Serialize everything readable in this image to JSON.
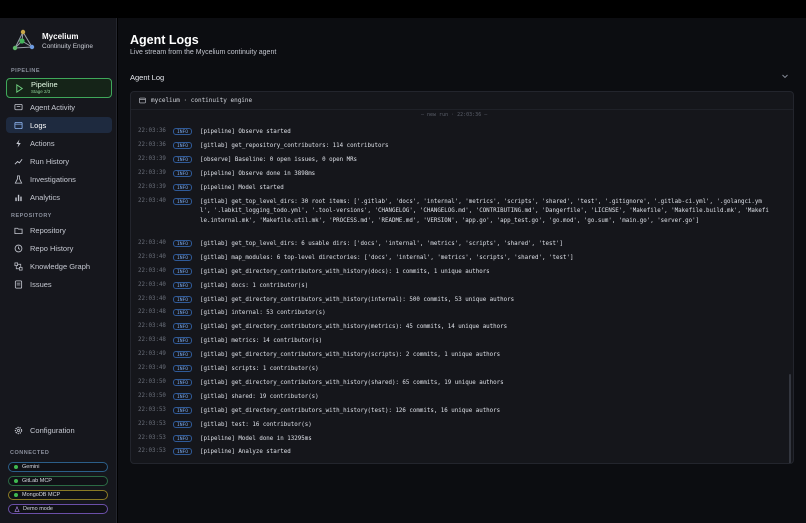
{
  "brand": {
    "name": "Mycelium",
    "subtitle": "Continuity Engine"
  },
  "sidebar": {
    "section_pipeline": "PIPELINE",
    "pipeline": {
      "label": "Pipeline",
      "sub": "Stage 2/3"
    },
    "items_main": [
      {
        "label": "Agent Activity",
        "icon": "chat-icon"
      },
      {
        "label": "Logs",
        "icon": "logs-icon",
        "active": true
      },
      {
        "label": "Actions",
        "icon": "bolt-icon"
      },
      {
        "label": "Run History",
        "icon": "trend-icon"
      },
      {
        "label": "Investigations",
        "icon": "flask-icon"
      },
      {
        "label": "Analytics",
        "icon": "bar-chart-icon"
      }
    ],
    "section_repo": "REPOSITORY",
    "items_repo": [
      {
        "label": "Repository",
        "icon": "folder-icon"
      },
      {
        "label": "Repo History",
        "icon": "history-icon"
      },
      {
        "label": "Knowledge Graph",
        "icon": "graph-icon"
      },
      {
        "label": "Issues",
        "icon": "issues-icon"
      }
    ],
    "configuration": "Configuration",
    "connected_label": "CONNECTED",
    "connections": [
      {
        "label": "Gemini",
        "color": "#3fb950",
        "border": "#2b5e88"
      },
      {
        "label": "GitLab MCP",
        "color": "#3fb950",
        "border": "#2b6a44"
      },
      {
        "label": "MongoDB MCP",
        "color": "#3fb950",
        "border": "#8a7a25"
      },
      {
        "label": "Demo mode",
        "color": "#b48cf0",
        "border": "#6b4fa8"
      }
    ]
  },
  "main": {
    "title": "Agent Logs",
    "subtitle": "Live stream from the Mycelium continuity agent",
    "panel_title": "Agent Log",
    "log_header": "mycelium · continuity engine",
    "divider": "— new run · 22:03:36 —",
    "level": "INFO",
    "logs": [
      {
        "t": "22:03:36",
        "m": "[pipeline] Observe started"
      },
      {
        "t": "22:03:36",
        "m": "[gitlab] get_repository_contributors: 114 contributors"
      },
      {
        "t": "22:03:39",
        "m": "[observe] Baseline: 0 open issues, 0 open MRs"
      },
      {
        "t": "22:03:39",
        "m": "[pipeline] Observe done in 3898ms"
      },
      {
        "t": "22:03:39",
        "m": "[pipeline] Model started"
      },
      {
        "t": "22:03:40",
        "m": "[gitlab] get_top_level_dirs: 30 root items: ['.gitlab', 'docs', 'internal', 'metrics', 'scripts', 'shared', 'test', '.gitignore', '.gitlab-ci.yml', '.golangci.yml', '.labkit_logging_todo.yml', '.tool-versions', 'CHANGELOG', 'CHANGELOG.md', 'CONTRIBUTING.md', 'Dangerfile', 'LICENSE', 'Makefile', 'Makefile.build.mk', 'Makefile.internal.mk', 'Makefile.util.mk', 'PROCESS.md', 'README.md', 'VERSION', 'app.go', 'app_test.go', 'go.mod', 'go.sum', 'main.go', 'server.go']"
      },
      {
        "t": "22:03:40",
        "m": "[gitlab] get_top_level_dirs: 6 usable dirs: ['docs', 'internal', 'metrics', 'scripts', 'shared', 'test']"
      },
      {
        "t": "22:03:40",
        "m": "[gitlab] map_modules: 6 top-level directories: ['docs', 'internal', 'metrics', 'scripts', 'shared', 'test']"
      },
      {
        "t": "22:03:40",
        "m": "[gitlab] get_directory_contributors_with_history(docs): 1 commits, 1 unique authors"
      },
      {
        "t": "22:03:40",
        "m": "[gitlab] docs: 1 contributor(s)"
      },
      {
        "t": "22:03:40",
        "m": "[gitlab] get_directory_contributors_with_history(internal): 500 commits, 53 unique authors"
      },
      {
        "t": "22:03:48",
        "m": "[gitlab] internal: 53 contributor(s)"
      },
      {
        "t": "22:03:48",
        "m": "[gitlab] get_directory_contributors_with_history(metrics): 45 commits, 14 unique authors"
      },
      {
        "t": "22:03:48",
        "m": "[gitlab] metrics: 14 contributor(s)"
      },
      {
        "t": "22:03:49",
        "m": "[gitlab] get_directory_contributors_with_history(scripts): 2 commits, 1 unique authors"
      },
      {
        "t": "22:03:49",
        "m": "[gitlab] scripts: 1 contributor(s)"
      },
      {
        "t": "22:03:50",
        "m": "[gitlab] get_directory_contributors_with_history(shared): 65 commits, 19 unique authors"
      },
      {
        "t": "22:03:50",
        "m": "[gitlab] shared: 19 contributor(s)"
      },
      {
        "t": "22:03:53",
        "m": "[gitlab] get_directory_contributors_with_history(test): 126 commits, 16 unique authors"
      },
      {
        "t": "22:03:53",
        "m": "[gitlab] test: 16 contributor(s)"
      },
      {
        "t": "22:03:53",
        "m": "[pipeline] Model done in 13295ms"
      },
      {
        "t": "22:03:53",
        "m": "[pipeline] Analyze started"
      }
    ]
  }
}
